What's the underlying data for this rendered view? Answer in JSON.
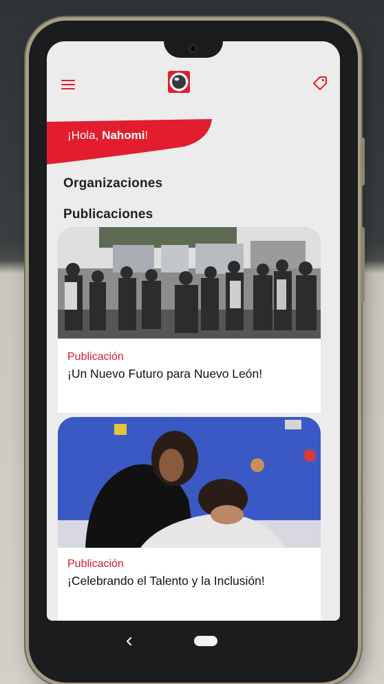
{
  "header": {
    "menu_icon": "hamburger-menu-icon",
    "logo_icon": "camera-eye-logo",
    "tag_icon": "tag-icon"
  },
  "greeting": {
    "prefix": "¡Hola, ",
    "name": "Nahomi",
    "suffix": "!"
  },
  "sections": {
    "organizations": "Organizaciones",
    "publications": "Publicaciones"
  },
  "posts": [
    {
      "category": "Publicación",
      "title": "¡Un Nuevo Futuro para Nuevo León!"
    },
    {
      "category": "Publicación",
      "title": "¡Celebrando el Talento y la Inclusión!"
    }
  ],
  "colors": {
    "accent": "#e11d2e",
    "screen_bg": "#ececec",
    "category_text": "#d3182b"
  },
  "system_nav": {
    "back_icon": "back-chevron-icon",
    "home_icon": "home-pill-icon"
  }
}
